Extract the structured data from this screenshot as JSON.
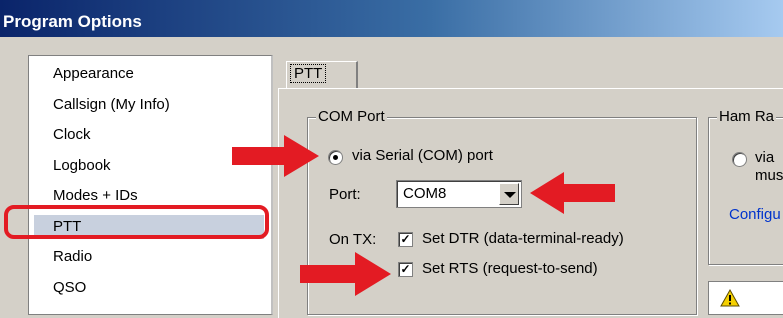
{
  "window": {
    "title": "Program Options"
  },
  "sidebar": {
    "items": [
      {
        "label": "Appearance"
      },
      {
        "label": "Callsign (My Info)"
      },
      {
        "label": "Clock"
      },
      {
        "label": "Logbook"
      },
      {
        "label": "Modes + IDs"
      },
      {
        "label": "PTT"
      },
      {
        "label": "Radio"
      },
      {
        "label": "QSO"
      }
    ],
    "selected": "PTT"
  },
  "tabs": [
    {
      "label": "PTT"
    }
  ],
  "com_port_group": {
    "title": "COM Port",
    "serial_radio_label": "via Serial (COM) port",
    "port_label": "Port:",
    "port_value": "COM8",
    "on_tx_label": "On TX:",
    "dtr_label": "Set DTR (data-terminal-ready)",
    "dtr_checked": true,
    "rts_label": "Set RTS (request-to-send)",
    "rts_checked": true
  },
  "ham_radio_group": {
    "title": "Ham Ra",
    "radio_label_line1": "via",
    "radio_label_line2": "mus",
    "configure_link": "Configu"
  },
  "warning": {
    "icon": "warning-icon"
  },
  "colors": {
    "annotation_red": "#e31b23",
    "link_blue": "#0033cc",
    "selection_bg": "#c8d0de"
  }
}
